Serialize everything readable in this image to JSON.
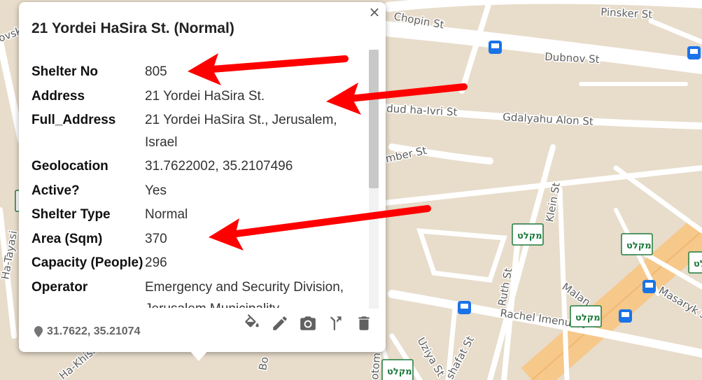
{
  "popup": {
    "title": "21 Yordei HaSira St. (Normal)",
    "close_icon": "×",
    "fields": [
      {
        "key": "Shelter No",
        "value": "805"
      },
      {
        "key": "Address",
        "value": "21 Yordei HaSira St."
      },
      {
        "key": "Full_Address",
        "value": "21 Yordei HaSira St., Jerusalem, Israel"
      },
      {
        "key": "Geolocation",
        "value": "31.7622002, 35.2107496"
      },
      {
        "key": "Active?",
        "value": "Yes"
      },
      {
        "key": "Shelter Type",
        "value": "Normal"
      },
      {
        "key": "Area (Sqm)",
        "value": "370"
      },
      {
        "key": "Capacity (People)",
        "value": "296"
      },
      {
        "key": "Operator",
        "value": "Emergency and Security Division, Jerusalem Municipality"
      }
    ],
    "footer_coords": "31.7622, 35.21074",
    "tools": [
      "paint-bucket-icon",
      "pencil-icon",
      "camera-icon",
      "directions-icon",
      "trash-icon"
    ]
  },
  "map": {
    "street_labels": {
      "chopin": "Chopin St",
      "pinsker": "Pinsker St",
      "dubnov": "Dubnov St",
      "dud": "dud ha-Ivri St",
      "gdalyahu": "Gdalyahu Alon St",
      "mber": "mber St",
      "klein": "Klein St",
      "ruth": "Ruth St",
      "rachel": "Rachel Imenu St",
      "masaryk": "Masaryk S",
      "malan": "Malan",
      "uzia": "Uziya St",
      "shafat": "shafat St",
      "otom": "otom",
      "ha_tayasi": "Ha-Tayasi",
      "ha_khish": "Ha-Khish",
      "ovsk": "ovsk",
      "bo": "Bo"
    },
    "shelter_label": "מקלט",
    "colors": {
      "background": "#e8dccb",
      "road": "#ffffff",
      "highway": "#f6c88a",
      "bus": "#1a73e8",
      "shelter": "#1e7a3c"
    }
  },
  "annotations": {
    "arrow_color": "#ff0000"
  }
}
